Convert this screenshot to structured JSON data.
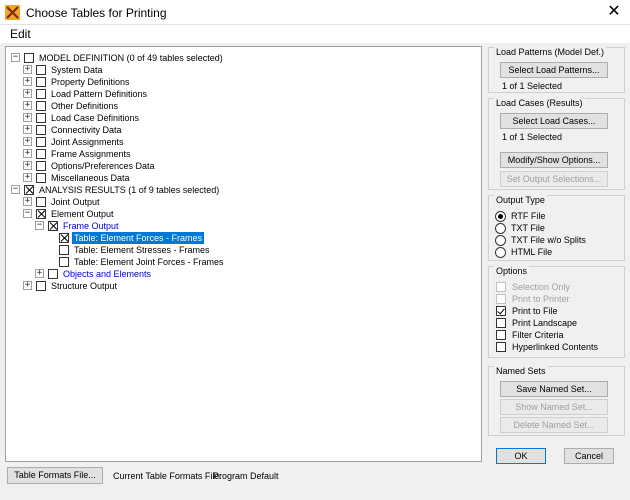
{
  "window": {
    "title": "Choose Tables for Printing",
    "close_glyph": "✕"
  },
  "menu": {
    "edit": "Edit"
  },
  "colors": {
    "selection": "#0078d7",
    "link_blue": "#0000d0",
    "disabled": "#a0a0a0"
  },
  "tree": {
    "model_definition": "MODEL DEFINITION  (0 of 49 tables selected)",
    "system_data": "System Data",
    "property_definitions": "Property Definitions",
    "load_pattern_definitions": "Load Pattern Definitions",
    "other_definitions": "Other Definitions",
    "load_case_definitions": "Load Case Definitions",
    "connectivity_data": "Connectivity Data",
    "joint_assignments": "Joint Assignments",
    "frame_assignments": "Frame Assignments",
    "options_preferences": "Options/Preferences Data",
    "miscellaneous_data": "Miscellaneous Data",
    "analysis_results": "ANALYSIS RESULTS  (1 of 9 tables selected)",
    "joint_output": "Joint Output",
    "element_output": "Element Output",
    "frame_output": "Frame Output",
    "table_element_forces": "Table:  Element Forces - Frames",
    "table_element_stresses": "Table:  Element Stresses - Frames",
    "table_element_joint_forces": "Table:  Element Joint Forces - Frames",
    "objects_and_elements": "Objects and Elements",
    "structure_output": "Structure Output"
  },
  "load_patterns": {
    "title": "Load Patterns (Model Def.)",
    "button": "Select Load Patterns...",
    "status": "1 of 1 Selected"
  },
  "load_cases": {
    "title": "Load Cases (Results)",
    "button": "Select Load Cases...",
    "status": "1 of 1 Selected",
    "modify_button": "Modify/Show Options...",
    "set_output_button": "Set Output Selections..."
  },
  "output_type": {
    "title": "Output Type",
    "rtf": "RTF File",
    "txt": "TXT File",
    "txt_no_splits": "TXT File w/o Splits",
    "html": "HTML File"
  },
  "options": {
    "title": "Options",
    "selection_only": "Selection Only",
    "print_to_printer": "Print to Printer",
    "print_to_file": "Print to File",
    "print_landscape": "Print Landscape",
    "filter_criteria": "Filter Criteria",
    "hyperlinked_contents": "Hyperlinked Contents"
  },
  "named_sets": {
    "title": "Named Sets",
    "save": "Save Named Set...",
    "show": "Show Named Set...",
    "delete": "Delete Named Set..."
  },
  "bottom": {
    "table_formats_button": "Table Formats File...",
    "current_label": "Current Table Formats File:",
    "current_value": "Program Default",
    "ok": "OK",
    "cancel": "Cancel"
  }
}
